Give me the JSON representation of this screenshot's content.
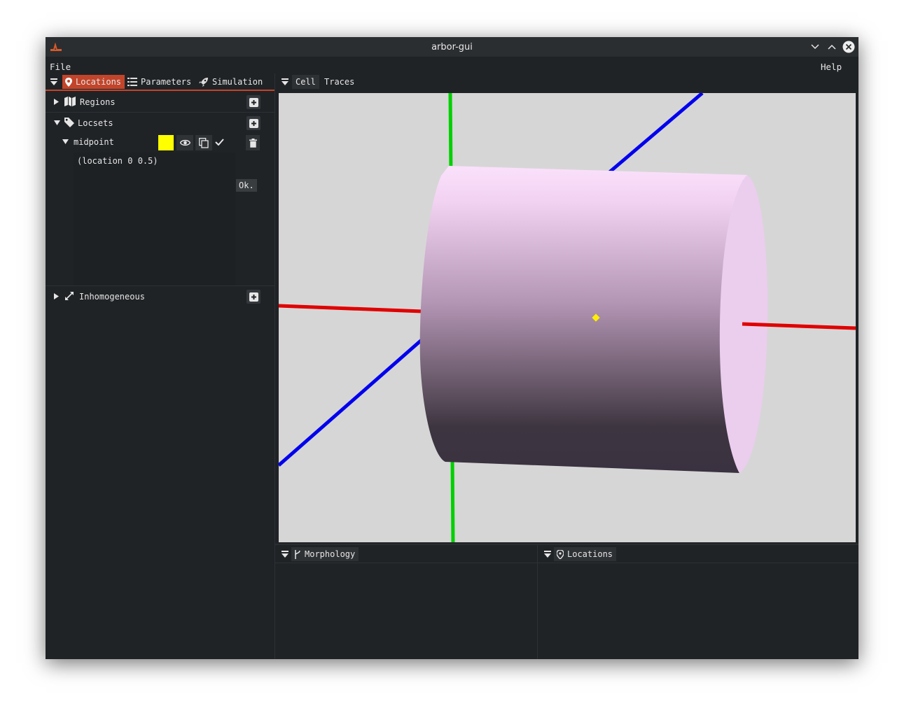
{
  "window": {
    "title": "arbor-gui"
  },
  "menu": {
    "file": "File",
    "help": "Help"
  },
  "left_panel": {
    "tabs": [
      {
        "label": "Locations",
        "icon": "map-marker-icon",
        "active": true
      },
      {
        "label": "Parameters",
        "icon": "list-icon",
        "active": false
      },
      {
        "label": "Simulation",
        "icon": "rocket-icon",
        "active": false
      }
    ],
    "regions": {
      "label": "Regions",
      "expanded": false
    },
    "locsets": {
      "label": "Locsets",
      "expanded": true,
      "items": [
        {
          "name": "midpoint",
          "color": "#ffff00",
          "expression": "(location 0 0.5)",
          "tooltip": "Ok."
        }
      ]
    },
    "inhomogeneous": {
      "label": "Inhomogeneous",
      "expanded": false
    }
  },
  "center_panel": {
    "tabs": [
      {
        "label": "Cell",
        "active": true
      },
      {
        "label": "Traces",
        "active": false
      }
    ]
  },
  "bottom_left_panel": {
    "tab": "Morphology",
    "icon": "fork-icon"
  },
  "bottom_right_panel": {
    "tab": "Locations",
    "icon": "map-marker-icon"
  },
  "colors": {
    "accent": "#c2452b",
    "background": "#202326",
    "viewport_background": "#d6d6d6",
    "axis_x": "#e00000",
    "axis_y": "#00d000",
    "axis_z": "#0000ee",
    "marker": "#ffee00"
  }
}
